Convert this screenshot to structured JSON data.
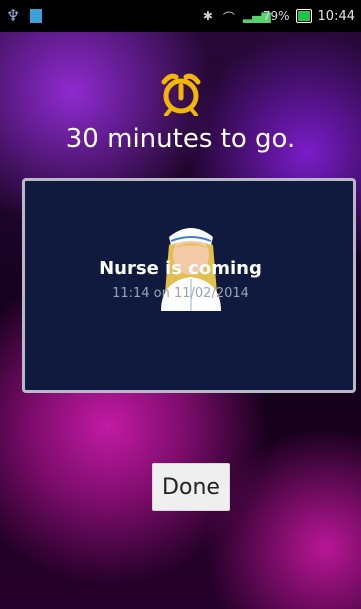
{
  "status_bar": {
    "battery_percent": "79%",
    "time": "10:44",
    "battery_color": "#25c24a"
  },
  "alarm": {
    "message": "30 minutes to go."
  },
  "notification_card": {
    "title": "Nurse is coming",
    "subtitle": "11:14 on 11/02/2014"
  },
  "actions": {
    "done_label": "Done"
  }
}
